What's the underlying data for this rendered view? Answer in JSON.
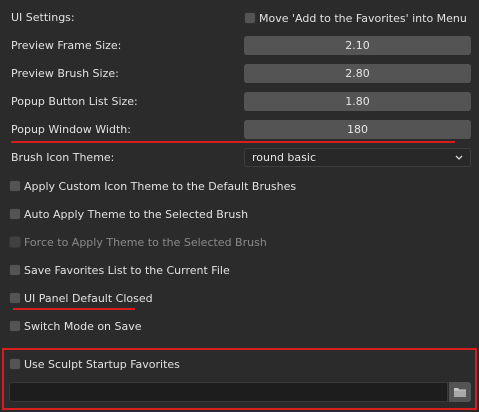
{
  "ui_settings": {
    "label": "UI Settings:",
    "move_favorites_label": "Move 'Add to the Favorites' into Menu",
    "move_favorites_checked": false
  },
  "fields": {
    "preview_frame_size": {
      "label": "Preview Frame Size:",
      "value": "2.10"
    },
    "preview_brush_size": {
      "label": "Preview Brush Size:",
      "value": "2.80"
    },
    "popup_button_list_size": {
      "label": "Popup Button List Size:",
      "value": "1.80"
    },
    "popup_window_width": {
      "label": "Popup Window Width:",
      "value": "180"
    }
  },
  "brush_icon_theme": {
    "label": "Brush Icon Theme:",
    "value": "round basic"
  },
  "checkboxes": {
    "apply_custom_icon_theme": {
      "label": "Apply Custom Icon Theme to the Default Brushes",
      "checked": false,
      "enabled": true
    },
    "auto_apply_theme": {
      "label": "Auto Apply Theme to the Selected Brush",
      "checked": false,
      "enabled": true
    },
    "force_apply_theme": {
      "label": "Force to Apply Theme to the Selected Brush",
      "checked": false,
      "enabled": false
    },
    "save_favorites_list": {
      "label": "Save Favorites List to the Current File",
      "checked": false,
      "enabled": true
    },
    "ui_panel_default_closed": {
      "label": "UI Panel Default Closed",
      "checked": false,
      "enabled": true
    },
    "switch_mode_on_save": {
      "label": "Switch Mode on Save",
      "checked": false,
      "enabled": true
    },
    "use_sculpt_startup_favorites": {
      "label": "Use Sculpt Startup Favorites",
      "checked": false,
      "enabled": true
    }
  },
  "startup_favorites_path": {
    "value": ""
  },
  "colors": {
    "background": "#2b2b2b",
    "field": "#545454",
    "highlight_red": "#d81d1d"
  },
  "icons": {
    "dropdown": "chevron-down-icon",
    "file_browser": "folder-icon"
  }
}
